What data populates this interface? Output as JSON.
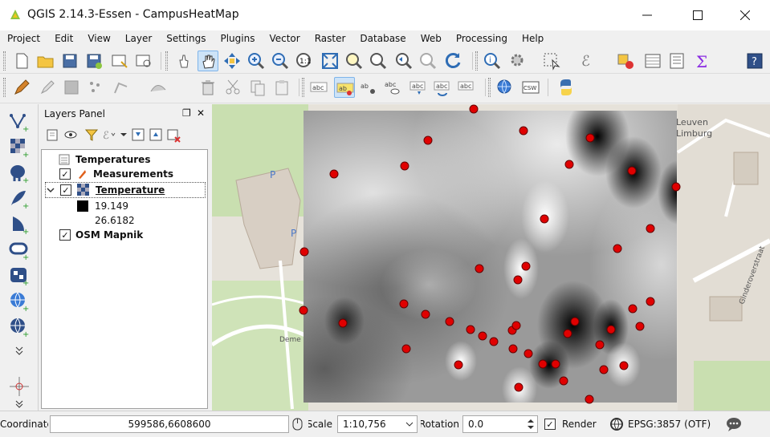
{
  "window": {
    "title": "QGIS 2.14.3-Essen - CampusHeatMap"
  },
  "menu": [
    "Project",
    "Edit",
    "View",
    "Layer",
    "Settings",
    "Plugins",
    "Vector",
    "Raster",
    "Database",
    "Web",
    "Processing",
    "Help"
  ],
  "toolbar": {
    "overflow": "»"
  },
  "layers_panel": {
    "title": "Layers Panel",
    "float_glyph": "❐",
    "close_glyph": "✕",
    "items": [
      {
        "label": "Temperatures",
        "type": "group"
      },
      {
        "label": "Measurements",
        "checked": true
      },
      {
        "label": "Temperature",
        "checked": true,
        "expanded": true
      },
      {
        "legend_min": "19.149",
        "legend_max": "26.6182"
      },
      {
        "label": "OSM Mapnik",
        "checked": true
      }
    ]
  },
  "statusbar": {
    "coord_label": "Coordinate",
    "coord_value": "599586,6608600",
    "scale_label": "Scale",
    "scale_value": "1:10,756",
    "rotation_label": "Rotation",
    "rotation_value": "0.0",
    "render_label": "Render",
    "crs": "EPSG:3857 (OTF)"
  },
  "map": {
    "labels": {
      "leuven": "Leuven",
      "limburg": "Limburg",
      "ginderover": "Ginderoverstraat",
      "deme": "Deme",
      "pin1": "P",
      "pin2": "P"
    },
    "points_color": "#e00000"
  }
}
